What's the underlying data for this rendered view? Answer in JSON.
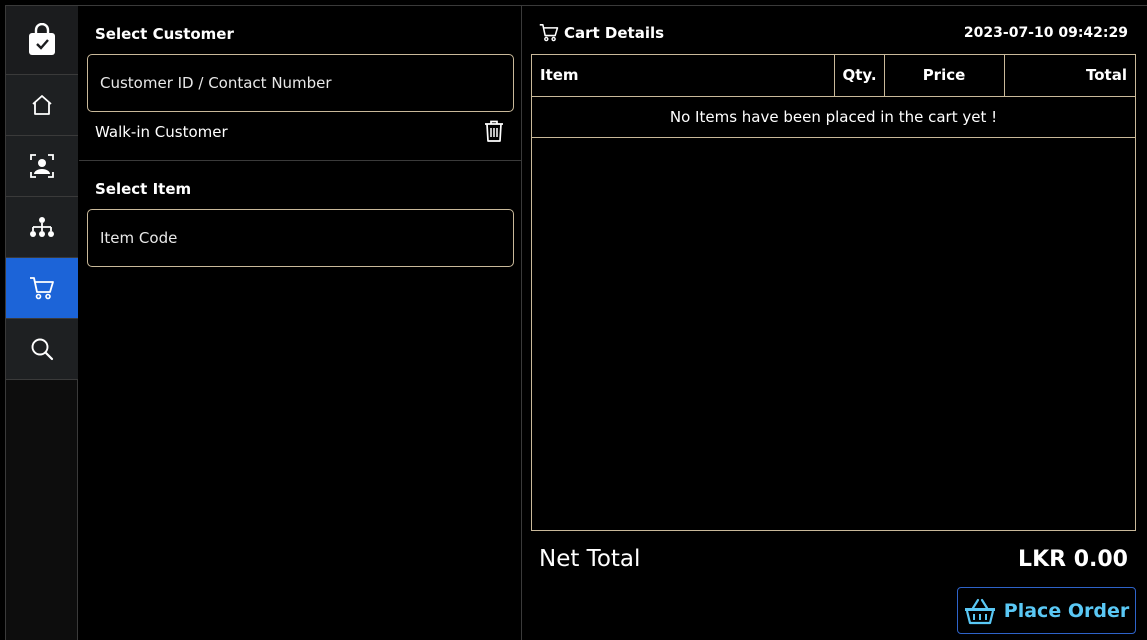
{
  "sidebar": {
    "items": [
      {
        "icon": "shopping-bag-check-icon"
      },
      {
        "icon": "home-icon"
      },
      {
        "icon": "customer-id-icon"
      },
      {
        "icon": "hierarchy-icon"
      },
      {
        "icon": "cart-icon",
        "active": true
      },
      {
        "icon": "search-icon"
      }
    ],
    "active_color": "#1c64d8"
  },
  "customer": {
    "title": "Select Customer",
    "placeholder": "Customer ID / Contact Number",
    "current": "Walk-in Customer"
  },
  "item": {
    "title": "Select Item",
    "placeholder": "Item Code"
  },
  "cart": {
    "title": "Cart Details",
    "datetime": "2023-07-10 09:42:29",
    "columns": {
      "item": "Item",
      "qty": "Qty.",
      "price": "Price",
      "total": "Total"
    },
    "empty_message": "No Items have been placed in the cart yet !"
  },
  "summary": {
    "net_total_label": "Net Total",
    "net_total_value": "LKR 0.00"
  },
  "actions": {
    "place_order_label": "Place Order",
    "place_order_color": "#5ac8f5"
  }
}
